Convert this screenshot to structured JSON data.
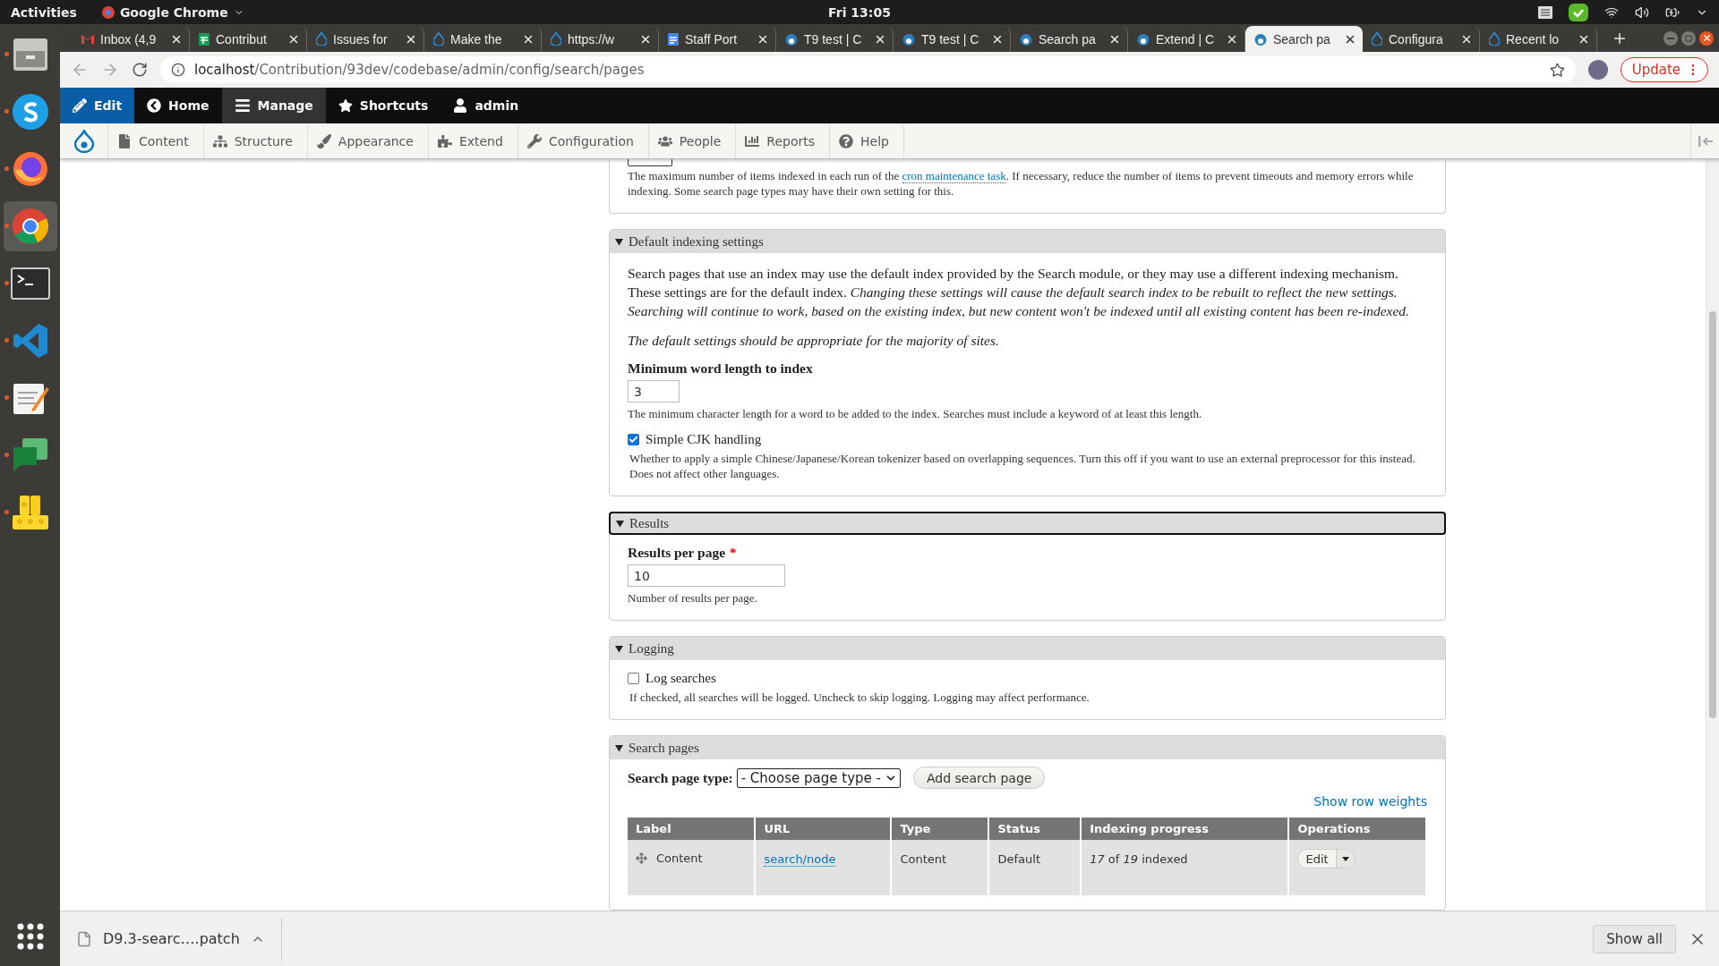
{
  "system_bar": {
    "activities": "Activities",
    "app": "Google Chrome",
    "clock": "Fri 13:05"
  },
  "dock": [
    {
      "kind": "files",
      "running": true,
      "selected": false
    },
    {
      "kind": "skype",
      "running": true,
      "selected": false
    },
    {
      "kind": "firefox",
      "running": true,
      "selected": false
    },
    {
      "kind": "chrome",
      "running": true,
      "selected": true
    },
    {
      "kind": "terminal",
      "running": true,
      "selected": false
    },
    {
      "kind": "vscode",
      "running": true,
      "selected": false
    },
    {
      "kind": "editor",
      "running": true,
      "selected": false
    },
    {
      "kind": "chat",
      "running": true,
      "selected": false
    },
    {
      "kind": "blocks",
      "running": true,
      "selected": false
    }
  ],
  "tabs": [
    {
      "title": "Inbox (4,9",
      "kind": "mail",
      "selected": false
    },
    {
      "title": "Contribut",
      "kind": "sheet",
      "selected": false
    },
    {
      "title": "Issues for",
      "kind": "drop",
      "selected": false
    },
    {
      "title": "Make the",
      "kind": "drop",
      "selected": false
    },
    {
      "title": "https://w",
      "kind": "drop",
      "selected": false
    },
    {
      "title": "Staff Port",
      "kind": "doc",
      "selected": false
    },
    {
      "title": "T9 test | C",
      "kind": "head",
      "selected": false
    },
    {
      "title": "T9 test | C",
      "kind": "head",
      "selected": false
    },
    {
      "title": "Search pa",
      "kind": "head",
      "selected": false
    },
    {
      "title": "Extend | C",
      "kind": "head",
      "selected": false
    },
    {
      "title": "Search pa",
      "kind": "head",
      "selected": true
    },
    {
      "title": "Configura",
      "kind": "drop",
      "selected": false
    },
    {
      "title": "Recent lo",
      "kind": "drop",
      "selected": false
    }
  ],
  "address": {
    "host": "localhost",
    "path": "/Contribution/93dev/codebase/admin/config/search/pages"
  },
  "update_button": "Update",
  "toolbar": [
    {
      "label": "Edit",
      "kind": "edit",
      "selected": false
    },
    {
      "label": "Home",
      "kind": "home",
      "selected": false
    },
    {
      "label": "Manage",
      "kind": "manage",
      "selected": true
    },
    {
      "label": "Shortcuts",
      "kind": "shortcuts",
      "selected": false
    },
    {
      "label": "admin",
      "kind": "user",
      "selected": false
    }
  ],
  "tray": [
    {
      "label": "Content",
      "kind": "content"
    },
    {
      "label": "Structure",
      "kind": "structure"
    },
    {
      "label": "Appearance",
      "kind": "appearance"
    },
    {
      "label": "Extend",
      "kind": "extend"
    },
    {
      "label": "Configuration",
      "kind": "configuration"
    },
    {
      "label": "People",
      "kind": "people"
    },
    {
      "label": "Reports",
      "kind": "reports"
    },
    {
      "label": "Help",
      "kind": "help"
    }
  ],
  "sections": [
    {
      "kind": "tail",
      "description": {
        "before": "The maximum number of items indexed in each run of the ",
        "link": "cron maintenance task",
        "after": ". If necessary, reduce the number of items to prevent timeouts and memory errors while indexing. Some search page types may have their own setting for this."
      }
    },
    {
      "kind": "fieldset",
      "title": "Default indexing settings",
      "expanded": true,
      "focused": false,
      "items": [
        {
          "kind": "paragraph",
          "italic": false,
          "text": "Search pages that use an index may use the default index provided by the Search module, or they may use a different indexing mechanism. These settings are for the default index. *Changing these settings will cause the default search index to be rebuilt to reflect the new settings. Searching will continue to work, based on the existing index, but new content won't be indexed until all existing content has been re-indexed.*"
        },
        {
          "kind": "paragraph",
          "italic": true,
          "text": "The default settings should be appropriate for the majority of sites."
        },
        {
          "kind": "numberfield",
          "label": "Minimum word length to index",
          "value": "3",
          "description": "The minimum character length for a word to be added to the index. Searches must include a keyword of at least this length."
        },
        {
          "kind": "checkbox",
          "label": "Simple CJK handling",
          "checked": true,
          "description": "Whether to apply a simple Chinese/Japanese/Korean tokenizer based on overlapping sequences. Turn this off if you want to use an external preprocessor for this instead. Does not affect other languages."
        }
      ]
    },
    {
      "kind": "fieldset",
      "title": "Results",
      "expanded": true,
      "focused": true,
      "items": [
        {
          "kind": "textfield",
          "label": "Results per page",
          "required_mark": "*",
          "value": "10",
          "description": "Number of results per page."
        }
      ]
    },
    {
      "kind": "fieldset",
      "title": "Logging",
      "expanded": true,
      "focused": false,
      "items": [
        {
          "kind": "checkbox",
          "label": "Log searches",
          "checked": false,
          "description": "If checked, all searches will be logged. Uncheck to skip logging. Logging may affect performance."
        }
      ]
    },
    {
      "kind": "fieldset",
      "title": "Search pages",
      "expanded": true,
      "focused": false,
      "items": [
        {
          "kind": "select_row",
          "label": "Search page type:",
          "value": "- Choose page type -",
          "button": "Add search page"
        },
        {
          "kind": "link",
          "text": "Show row weights"
        },
        {
          "kind": "table",
          "columns": [
            "Label",
            "URL",
            "Type",
            "Status",
            "Indexing progress",
            "Operations"
          ],
          "rows": [
            {
              "label": "Content",
              "url": "search/node",
              "type": "Content",
              "status": "Default",
              "progress": "*17* of *19* indexed",
              "operation": "Edit"
            }
          ]
        }
      ]
    }
  ],
  "download": {
    "file": "D9.3-searc….patch",
    "show_all": "Show all"
  }
}
